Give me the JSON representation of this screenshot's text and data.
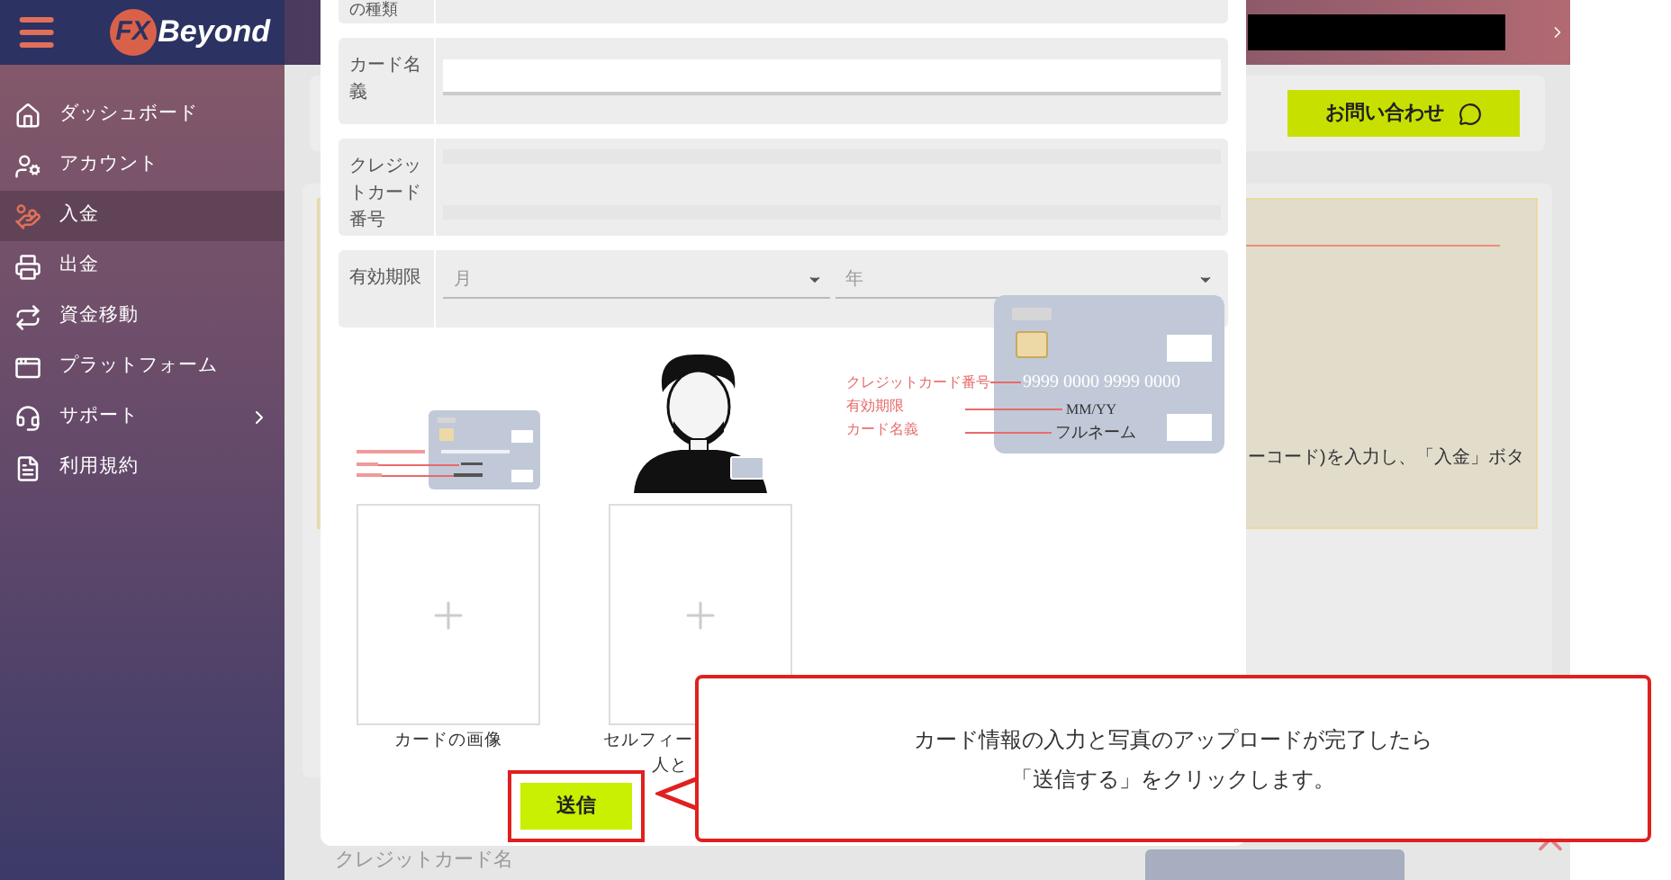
{
  "logo": {
    "mark": "FX",
    "name": "Beyond"
  },
  "sidebar": {
    "items": [
      {
        "label": "ダッシュボード",
        "kind": "home",
        "selected": false,
        "has_submenu": false
      },
      {
        "label": "アカウント",
        "kind": "account",
        "selected": false,
        "has_submenu": false
      },
      {
        "label": "入金",
        "kind": "deposit",
        "selected": true,
        "has_submenu": false
      },
      {
        "label": "出金",
        "kind": "withdraw",
        "selected": false,
        "has_submenu": false
      },
      {
        "label": "資金移動",
        "kind": "transfer",
        "selected": false,
        "has_submenu": false
      },
      {
        "label": "プラットフォーム",
        "kind": "platform",
        "selected": false,
        "has_submenu": false
      },
      {
        "label": "サポート",
        "kind": "support",
        "selected": false,
        "has_submenu": true
      },
      {
        "label": "利用規約",
        "kind": "terms",
        "selected": false,
        "has_submenu": false
      }
    ]
  },
  "page": {
    "contact_button": "お問い合わせ",
    "note_text": "ーコード)を入力し、「入金」ボタ",
    "footer_label": "クレジットカード名"
  },
  "modal": {
    "top_label": "の種類",
    "fields": [
      {
        "label": "カード名義",
        "kind": "text"
      },
      {
        "label": "クレジットカード番号",
        "kind": "masked"
      },
      {
        "label": "有効期限",
        "kind": "expiry",
        "placeholders": [
          "月",
          "年"
        ]
      }
    ],
    "card_diagram": {
      "labels": [
        "クレジットカード番号",
        "有効期限",
        "カード名義"
      ],
      "number": "9999 0000 9999 0000",
      "expiry": "MM/YY",
      "name": "フルネーム"
    },
    "uploads": [
      {
        "caption": [
          "カードの画像"
        ],
        "kind": "card"
      },
      {
        "caption": [
          "セルフィー",
          "人と"
        ],
        "kind": "selfie"
      }
    ],
    "submit_button": "送信"
  },
  "callout": {
    "lines": [
      "カード情報の入力と写真のアップロードが完了したら",
      "「送信する」をクリックします。"
    ]
  }
}
